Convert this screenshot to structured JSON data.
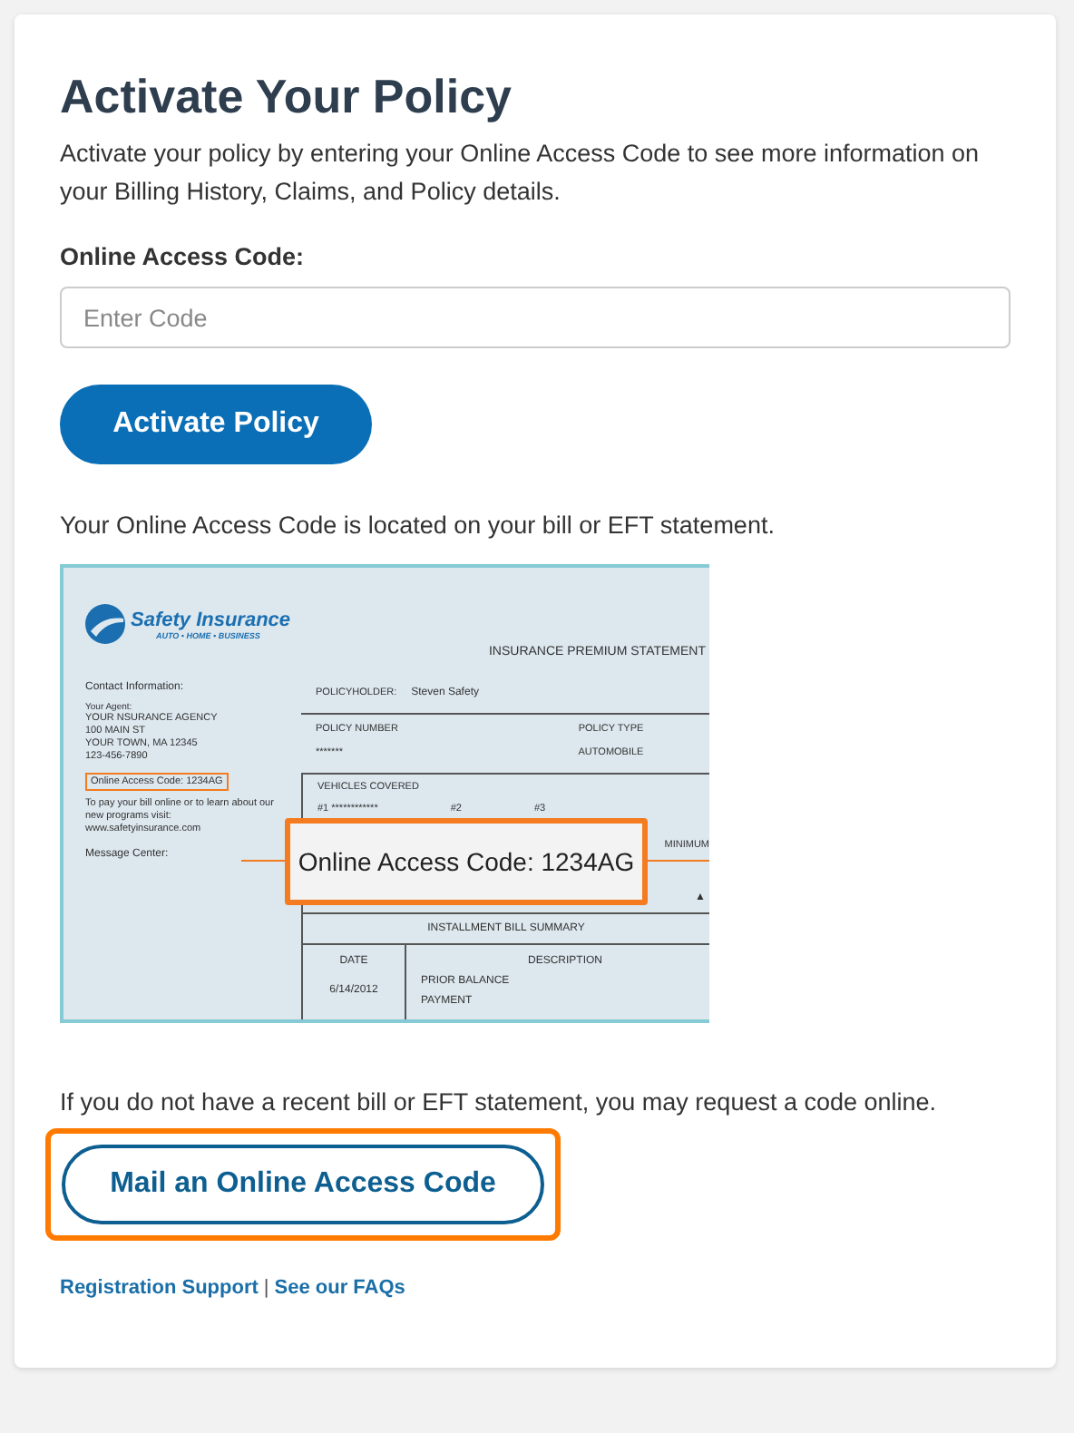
{
  "title": "Activate Your Policy",
  "intro": "Activate your policy by entering your Online Access Code to see more information on your Billing History, Claims, and Policy details.",
  "code_field": {
    "label": "Online Access Code:",
    "placeholder": "Enter Code"
  },
  "activate_button": "Activate Policy",
  "bill_note": "Your Online Access Code is located on your bill or EFT statement.",
  "bill_sample": {
    "logo_name": "Safety Insurance",
    "logo_tagline": "AUTO • HOME • BUSINESS",
    "statement_title": "INSURANCE PREMIUM STATEMENT",
    "contact_label": "Contact Information:",
    "agent_label": "Your Agent:",
    "agent_lines": [
      "YOUR NSURANCE AGENCY",
      "100 MAIN ST",
      "YOUR TOWN, MA 12345",
      "123-456-7890"
    ],
    "access_code_line": "Online Access Code: 1234AG",
    "pay_text": "To pay your bill online or to learn about our new programs visit: www.safetyinsurance.com",
    "message_center": "Message Center:",
    "policyholder_label": "POLICYHOLDER:",
    "policyholder": "Steven Safety",
    "policy_number_label": "POLICY NUMBER",
    "policy_number": "*******",
    "policy_type_label": "POLICY TYPE",
    "policy_type": "AUTOMOBILE",
    "vehicles_label": "VEHICLES COVERED",
    "vehicles": [
      "#1 ************",
      "#2",
      "#3"
    ],
    "minimum_label": "MINIMUM",
    "marker": "▲",
    "summary_title": "INSTALLMENT BILL SUMMARY",
    "columns": [
      "DATE",
      "DESCRIPTION"
    ],
    "date": "6/14/2012",
    "descriptions": [
      "PRIOR BALANCE",
      "PAYMENT"
    ],
    "callout": "Online Access Code:  1234AG"
  },
  "request_note": "If you do not have a recent bill or EFT statement, you may request a code online.",
  "mail_button": {
    "label": "Mail an Online Access Code",
    "highlighted": true
  },
  "links": [
    "Registration Support",
    "See our FAQs"
  ],
  "link_separator": "|"
}
